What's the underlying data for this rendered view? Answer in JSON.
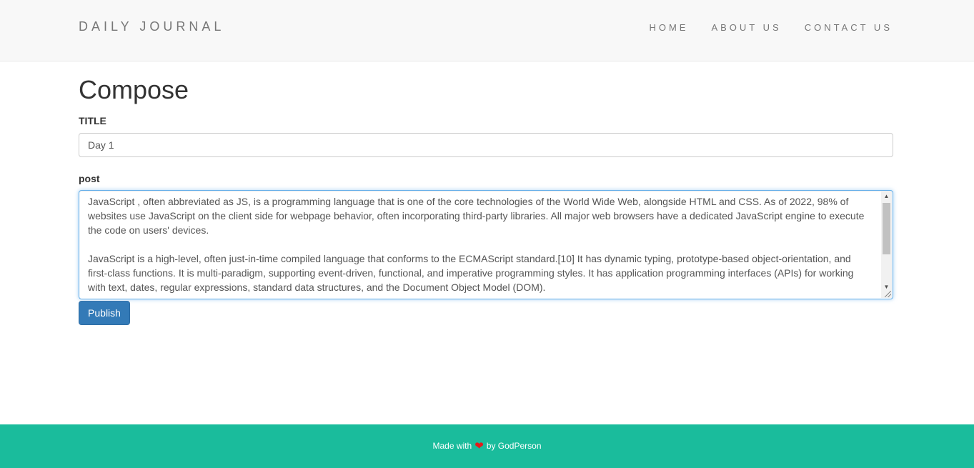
{
  "navbar": {
    "brand": "DAILY JOURNAL",
    "links": [
      "HOME",
      "ABOUT US",
      "CONTACT US"
    ]
  },
  "compose": {
    "heading": "Compose",
    "title_label": "TITLE",
    "title_value": "Day 1",
    "post_label": "post",
    "post_text": "JavaScript , often abbreviated as JS, is a programming language that is one of the core technologies of the World Wide Web, alongside HTML and CSS. As of 2022, 98% of websites use JavaScript on the client side for webpage behavior, often incorporating third-party libraries. All major web browsers have a dedicated JavaScript engine to execute the code on users' devices.\n\nJavaScript is a high-level, often just-in-time compiled language that conforms to the ECMAScript standard.[10] It has dynamic typing, prototype-based object-orientation, and first-class functions. It is multi-paradigm, supporting event-driven, functional, and imperative programming styles. It has application programming interfaces (APIs) for working with text, dates, regular expressions, standard data structures, and the Document Object Model (DOM).",
    "publish_label": "Publish"
  },
  "footer": {
    "made_with": "Made with",
    "by": "by GodPerson",
    "heart_icon": "heart-icon",
    "heart_color": "#e31b1b"
  },
  "colors": {
    "navbar_bg": "#f8f8f8",
    "primary": "#337ab7",
    "footer_bg": "#1abc9c"
  }
}
